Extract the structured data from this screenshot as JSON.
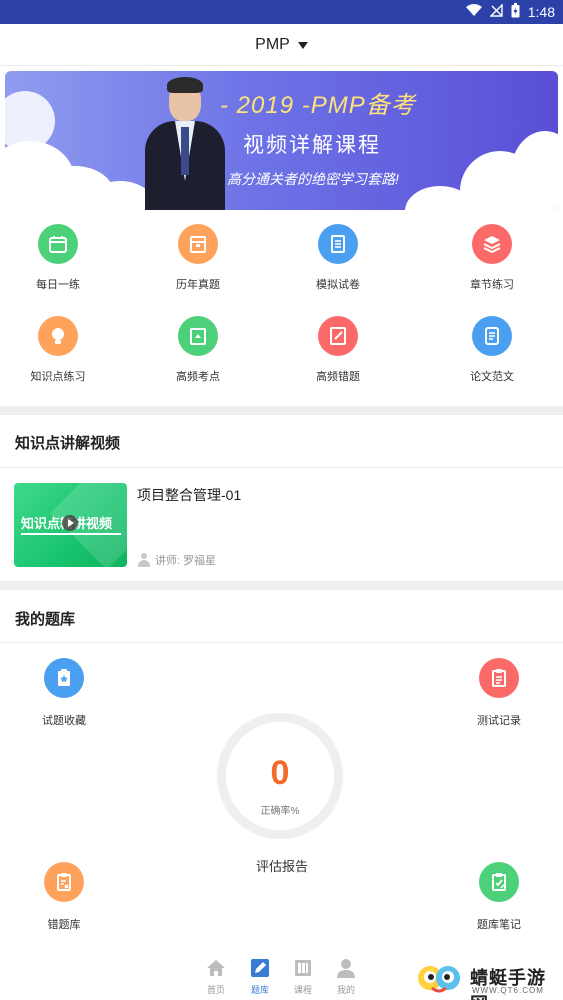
{
  "status_bar": {
    "time": "1:48"
  },
  "header": {
    "title": "PMP"
  },
  "banner": {
    "title": "- 2019 -PMP备考",
    "subtitle": "视频详解课程",
    "description": "高分通关者的绝密学习套路!"
  },
  "grid": {
    "items": [
      {
        "label": "每日一练",
        "icon": "calendar-icon",
        "color": "#4cd17a"
      },
      {
        "label": "历年真题",
        "icon": "archive-icon",
        "color": "#ffa25c"
      },
      {
        "label": "模拟试卷",
        "icon": "paper-icon",
        "color": "#4a9ff0"
      },
      {
        "label": "章节练习",
        "icon": "layers-icon",
        "color": "#fb6a68"
      },
      {
        "label": "知识点练习",
        "icon": "lightbulb-icon",
        "color": "#ffa25c"
      },
      {
        "label": "高频考点",
        "icon": "book-icon",
        "color": "#4cd17a"
      },
      {
        "label": "高频错题",
        "icon": "notebook-icon",
        "color": "#fb6a68"
      },
      {
        "label": "论文范文",
        "icon": "document-icon",
        "color": "#4a9ff0"
      }
    ]
  },
  "videos": {
    "section_title": "知识点讲解视频",
    "items": [
      {
        "title": "项目整合管理-01",
        "teacher": "讲师: 罗福星",
        "thumb_text": "知识点精讲视频"
      }
    ]
  },
  "bank": {
    "section_title": "我的题库",
    "favorites_label": "试题收藏",
    "records_label": "测试记录",
    "wrong_label": "错题库",
    "notes_label": "题库笔记",
    "accuracy_value": "0",
    "accuracy_label": "正确率%",
    "report_label": "评估报告"
  },
  "tabbar": {
    "tabs": [
      {
        "label": "首页",
        "icon": "home-icon",
        "active": false
      },
      {
        "label": "题库",
        "icon": "edit-icon",
        "active": true
      },
      {
        "label": "课程",
        "icon": "book-icon",
        "active": false
      },
      {
        "label": "我的",
        "icon": "profile-icon",
        "active": false
      }
    ]
  },
  "watermark": {
    "name": "蜻蜓手游网",
    "url": "WWW.QT6.COM"
  },
  "colors": {
    "status_bar": "#2c41a8",
    "accent": "#3a7bd5",
    "accuracy": "#f26b2c"
  }
}
